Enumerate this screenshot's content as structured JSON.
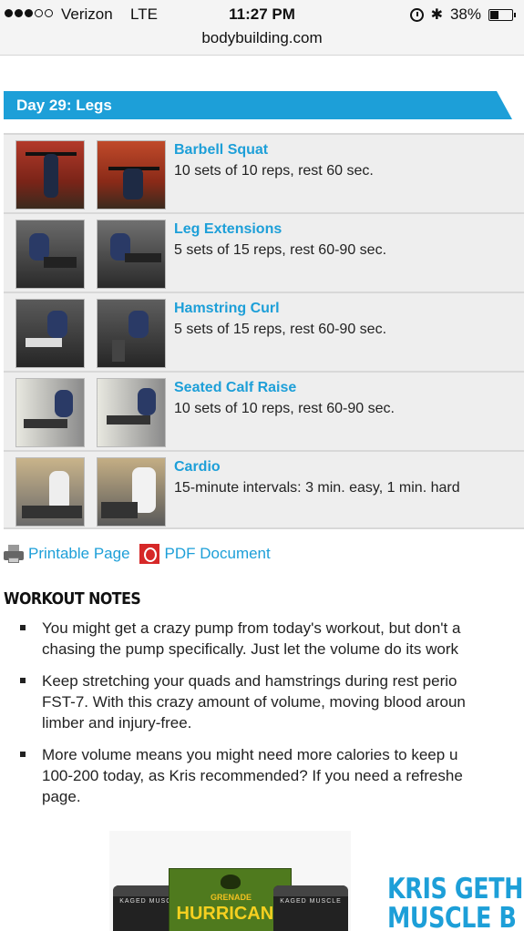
{
  "status_bar": {
    "carrier": "Verizon",
    "network": "LTE",
    "time": "11:27 PM",
    "battery": "38%",
    "battery_level": 0.38,
    "icons": [
      "signal-dots-icon",
      "alarm-icon",
      "bluetooth-icon",
      "battery-icon"
    ]
  },
  "browser": {
    "url": "bodybuilding.com"
  },
  "day": {
    "title": "Day 29: Legs"
  },
  "exercises": [
    {
      "name": "Barbell Squat",
      "detail": "10 sets of 10 reps, rest 60 sec."
    },
    {
      "name": "Leg Extensions",
      "detail": "5 sets of 15 reps, rest 60-90 sec."
    },
    {
      "name": "Hamstring Curl",
      "detail": "5 sets of 15 reps, rest 60-90 sec."
    },
    {
      "name": "Seated Calf Raise",
      "detail": "10 sets of 10 reps, rest 60-90 sec."
    },
    {
      "name": "Cardio",
      "detail": "15-minute intervals: 3 min. easy, 1 min. hard"
    }
  ],
  "links": {
    "printable": "Printable Page",
    "pdf": "PDF Document"
  },
  "notes": {
    "heading": "WORKOUT NOTES",
    "items": [
      {
        "lines": [
          "You might get a crazy pump from today's workout, but don't a",
          "chasing the pump specifically. Just let the volume do its work"
        ]
      },
      {
        "lines": [
          "Keep stretching your quads and hamstrings during rest perio",
          "FST-7. With this crazy amount of volume, moving blood aroun",
          "limber and injury-free."
        ]
      },
      {
        "lines": [
          "More volume means you might need more calories to keep u",
          "100-200 today, as Kris recommended? If you need a refreshe",
          "page."
        ]
      }
    ]
  },
  "ad": {
    "tub_label": "KAGED MUSCLE",
    "box_brand": "GRENADE",
    "box_text": "HURRICANE",
    "headline_line1": "KRIS GETH",
    "headline_line2": "MUSCLE B"
  },
  "colors": {
    "accent": "#1d9fd8",
    "row_bg": "#eeeeee",
    "pdf_red": "#d62828"
  }
}
